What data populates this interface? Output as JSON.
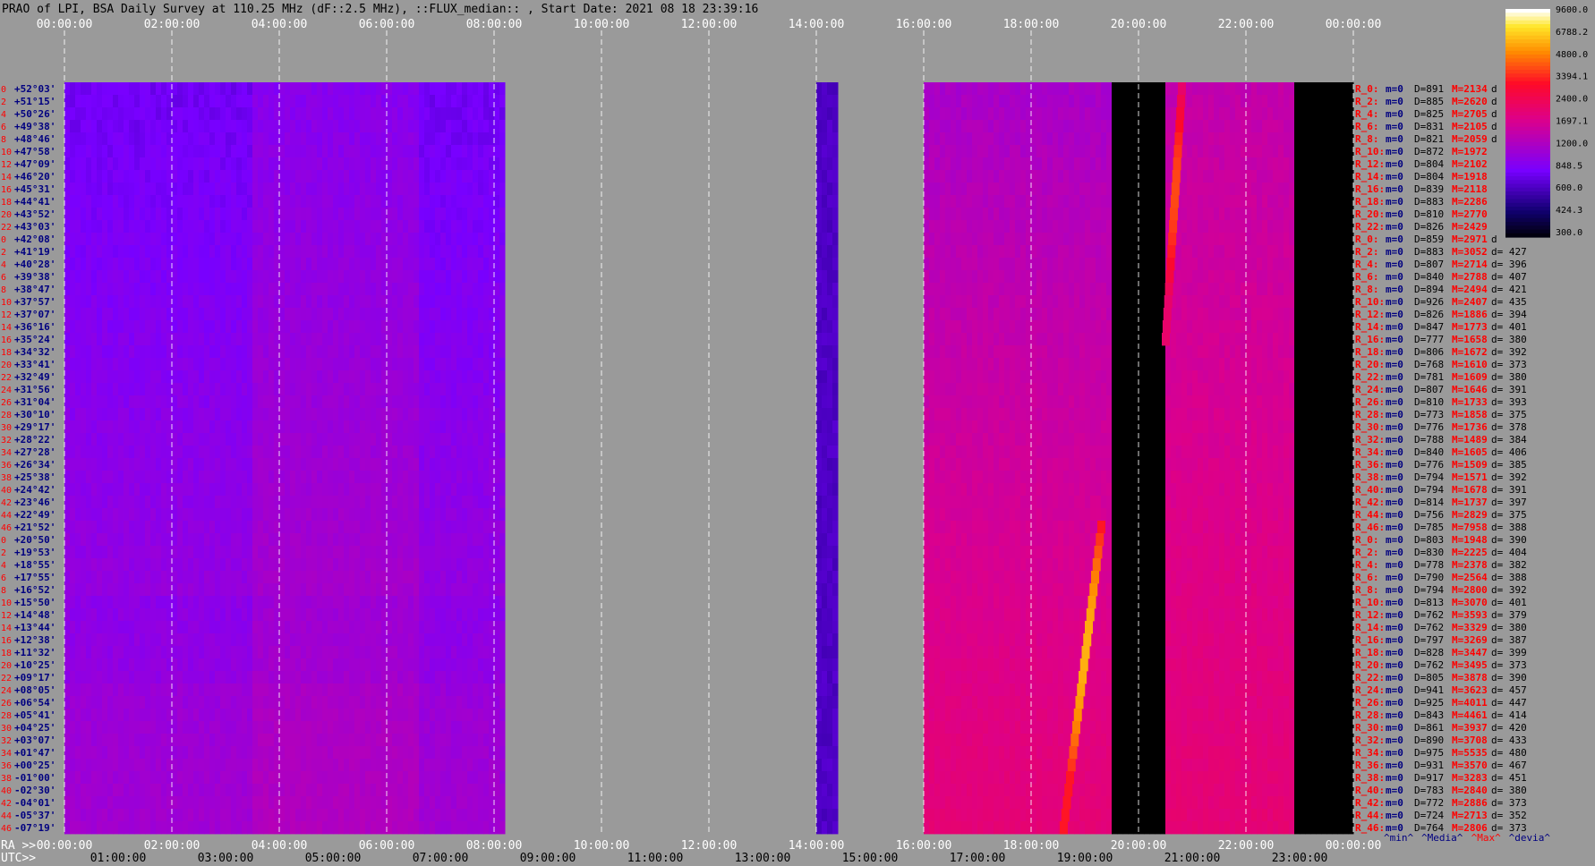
{
  "title": "PRAO of LPI, BSA Daily Survey at 110.25 MHz (dF::2.5 MHz), ::FLUX_median:: , Start Date: 2021 08 18 23:39:16",
  "chart_data": {
    "type": "heatmap",
    "title": "PRAO of LPI, BSA Daily Survey at 110.25 MHz (dF::2.5 MHz), ::FLUX_median:: , Start Date: 2021 08 18 23:39:16",
    "x_axis_top": {
      "ticks": [
        "00:00:00",
        "02:00:00",
        "04:00:00",
        "06:00:00",
        "08:00:00",
        "10:00:00",
        "12:00:00",
        "14:00:00",
        "16:00:00",
        "18:00:00",
        "20:00:00",
        "22:00:00",
        "00:00:00"
      ]
    },
    "x_axis_ra": {
      "label": "RA >>",
      "ticks": [
        "00:00:00",
        "02:00:00",
        "04:00:00",
        "06:00:00",
        "08:00:00",
        "10:00:00",
        "12:00:00",
        "14:00:00",
        "16:00:00",
        "18:00:00",
        "20:00:00",
        "22:00:00",
        "00:00:00"
      ]
    },
    "x_axis_utc": {
      "label": "UTC>>",
      "ticks": [
        "01:00:00",
        "03:00:00",
        "05:00:00",
        "07:00:00",
        "09:00:00",
        "11:00:00",
        "13:00:00",
        "15:00:00",
        "17:00:00",
        "19:00:00",
        "21:00:00",
        "23:00:00"
      ]
    },
    "row_numbers": [
      "0",
      "2",
      "4",
      "6",
      "8",
      "10",
      "12",
      "14",
      "16",
      "18",
      "20",
      "22",
      "0",
      "2",
      "4",
      "6",
      "8",
      "10",
      "12",
      "14",
      "16",
      "18",
      "20",
      "22",
      "24",
      "26",
      "28",
      "30",
      "32",
      "34",
      "36",
      "38",
      "40",
      "42",
      "44",
      "46",
      "0",
      "2",
      "4",
      "6",
      "8",
      "10",
      "12",
      "14",
      "16",
      "18",
      "20",
      "22",
      "24",
      "26",
      "28",
      "30",
      "32",
      "34",
      "36",
      "38",
      "40",
      "42",
      "44",
      "46"
    ],
    "declinations": [
      "+52°03'",
      "+51°15'",
      "+50°26'",
      "+49°38'",
      "+48°46'",
      "+47°58'",
      "+47°09'",
      "+46°20'",
      "+45°31'",
      "+44°41'",
      "+43°52'",
      "+43°03'",
      "+42°08'",
      "+41°19'",
      "+40°28'",
      "+39°38'",
      "+38°47'",
      "+37°57'",
      "+37°07'",
      "+36°16'",
      "+35°24'",
      "+34°32'",
      "+33°41'",
      "+32°49'",
      "+31°56'",
      "+31°04'",
      "+30°10'",
      "+29°17'",
      "+28°22'",
      "+27°28'",
      "+26°34'",
      "+25°38'",
      "+24°42'",
      "+23°46'",
      "+22°49'",
      "+21°52'",
      "+20°50'",
      "+19°53'",
      "+18°55'",
      "+17°55'",
      "+16°52'",
      "+15°50'",
      "+14°48'",
      "+13°44'",
      "+12°38'",
      "+11°32'",
      "+10°25'",
      "+09°17'",
      "+08°05'",
      "+06°54'",
      "+05°41'",
      "+04°25'",
      "+03°07'",
      "+01°47'",
      "+00°25'",
      "-01°00'",
      "-02°30'",
      "-04°01'",
      "-05°37'",
      "-07°19'"
    ],
    "colorbar": {
      "ticks": [
        "9600.0",
        "6788.2",
        "4800.0",
        "3394.1",
        "2400.0",
        "1697.1",
        "1200.0",
        "848.5",
        "600.0",
        "424.3",
        "300.0"
      ]
    },
    "data_segments_hours": [
      [
        0.0,
        8.2
      ],
      [
        14.0,
        14.4
      ],
      [
        16.0,
        19.5
      ],
      [
        19.5,
        20.5
      ],
      [
        20.5,
        22.9
      ],
      [
        22.9,
        24.0
      ]
    ],
    "source_tracks": [
      {
        "dec_start": "+21°52'",
        "dec_end": "-07°19'",
        "ra_start": 19.3,
        "ra_end": 18.6,
        "peak_flux": 6000
      },
      {
        "dec_start": "+52°03'",
        "dec_end": "+35°24'",
        "ra_start": 20.8,
        "ra_end": 20.5,
        "peak_flux": 4000
      }
    ],
    "legend_footer": [
      {
        "text": "^min^",
        "color": "#000080"
      },
      {
        "text": "^Media^",
        "color": "#000080"
      },
      {
        "text": "^Max^",
        "color": "#ff0000"
      },
      {
        "text": "^devia^",
        "color": "#000080"
      }
    ],
    "row_stats": [
      {
        "r": "R_0:",
        "m": "m=0",
        "D": "D=891",
        "M": "M=2134",
        "d": "d"
      },
      {
        "r": "R_2:",
        "m": "m=0",
        "D": "D=885",
        "M": "M=2620",
        "d": "d"
      },
      {
        "r": "R_4:",
        "m": "m=0",
        "D": "D=825",
        "M": "M=2705",
        "d": "d"
      },
      {
        "r": "R_6:",
        "m": "m=0",
        "D": "D=831",
        "M": "M=2105",
        "d": "d"
      },
      {
        "r": "R_8:",
        "m": "m=0",
        "D": "D=821",
        "M": "M=2059",
        "d": "d"
      },
      {
        "r": "R_10:",
        "m": "m=0",
        "D": "D=872",
        "M": "M=1972",
        "d": ""
      },
      {
        "r": "R_12:",
        "m": "m=0",
        "D": "D=804",
        "M": "M=2102",
        "d": ""
      },
      {
        "r": "R_14:",
        "m": "m=0",
        "D": "D=804",
        "M": "M=1918",
        "d": ""
      },
      {
        "r": "R_16:",
        "m": "m=0",
        "D": "D=839",
        "M": "M=2118",
        "d": ""
      },
      {
        "r": "R_18:",
        "m": "m=0",
        "D": "D=883",
        "M": "M=2286",
        "d": ""
      },
      {
        "r": "R_20:",
        "m": "m=0",
        "D": "D=810",
        "M": "M=2770",
        "d": ""
      },
      {
        "r": "R_22:",
        "m": "m=0",
        "D": "D=826",
        "M": "M=2429",
        "d": ""
      },
      {
        "r": "R_0:",
        "m": "m=0",
        "D": "D=859",
        "M": "M=2971",
        "d": "d"
      },
      {
        "r": "R_2:",
        "m": "m=0",
        "D": "D=883",
        "M": "M=3052",
        "d": "d= 427"
      },
      {
        "r": "R_4:",
        "m": "m=0",
        "D": "D=807",
        "M": "M=2714",
        "d": "d= 396"
      },
      {
        "r": "R_6:",
        "m": "m=0",
        "D": "D=840",
        "M": "M=2788",
        "d": "d= 407"
      },
      {
        "r": "R_8:",
        "m": "m=0",
        "D": "D=894",
        "M": "M=2494",
        "d": "d= 421"
      },
      {
        "r": "R_10:",
        "m": "m=0",
        "D": "D=926",
        "M": "M=2407",
        "d": "d= 435"
      },
      {
        "r": "R_12:",
        "m": "m=0",
        "D": "D=826",
        "M": "M=1886",
        "d": "d= 394"
      },
      {
        "r": "R_14:",
        "m": "m=0",
        "D": "D=847",
        "M": "M=1773",
        "d": "d= 401"
      },
      {
        "r": "R_16:",
        "m": "m=0",
        "D": "D=777",
        "M": "M=1658",
        "d": "d= 380"
      },
      {
        "r": "R_18:",
        "m": "m=0",
        "D": "D=806",
        "M": "M=1672",
        "d": "d= 392"
      },
      {
        "r": "R_20:",
        "m": "m=0",
        "D": "D=768",
        "M": "M=1610",
        "d": "d= 373"
      },
      {
        "r": "R_22:",
        "m": "m=0",
        "D": "D=781",
        "M": "M=1609",
        "d": "d= 380"
      },
      {
        "r": "R_24:",
        "m": "m=0",
        "D": "D=807",
        "M": "M=1646",
        "d": "d= 391"
      },
      {
        "r": "R_26:",
        "m": "m=0",
        "D": "D=810",
        "M": "M=1733",
        "d": "d= 393"
      },
      {
        "r": "R_28:",
        "m": "m=0",
        "D": "D=773",
        "M": "M=1858",
        "d": "d= 375"
      },
      {
        "r": "R_30:",
        "m": "m=0",
        "D": "D=776",
        "M": "M=1736",
        "d": "d= 378"
      },
      {
        "r": "R_32:",
        "m": "m=0",
        "D": "D=788",
        "M": "M=1489",
        "d": "d= 384"
      },
      {
        "r": "R_34:",
        "m": "m=0",
        "D": "D=840",
        "M": "M=1605",
        "d": "d= 406"
      },
      {
        "r": "R_36:",
        "m": "m=0",
        "D": "D=776",
        "M": "M=1509",
        "d": "d= 385"
      },
      {
        "r": "R_38:",
        "m": "m=0",
        "D": "D=794",
        "M": "M=1571",
        "d": "d= 392"
      },
      {
        "r": "R_40:",
        "m": "m=0",
        "D": "D=794",
        "M": "M=1678",
        "d": "d= 391"
      },
      {
        "r": "R_42:",
        "m": "m=0",
        "D": "D=814",
        "M": "M=1737",
        "d": "d= 397"
      },
      {
        "r": "R_44:",
        "m": "m=0",
        "D": "D=756",
        "M": "M=2829",
        "d": "d= 375"
      },
      {
        "r": "R_46:",
        "m": "m=0",
        "D": "D=785",
        "M": "M=7958",
        "d": "d= 388"
      },
      {
        "r": "R_0:",
        "m": "m=0",
        "D": "D=803",
        "M": "M=1948",
        "d": "d= 390"
      },
      {
        "r": "R_2:",
        "m": "m=0",
        "D": "D=830",
        "M": "M=2225",
        "d": "d= 404"
      },
      {
        "r": "R_4:",
        "m": "m=0",
        "D": "D=778",
        "M": "M=2378",
        "d": "d= 382"
      },
      {
        "r": "R_6:",
        "m": "m=0",
        "D": "D=790",
        "M": "M=2564",
        "d": "d= 388"
      },
      {
        "r": "R_8:",
        "m": "m=0",
        "D": "D=794",
        "M": "M=2800",
        "d": "d= 392"
      },
      {
        "r": "R_10:",
        "m": "m=0",
        "D": "D=813",
        "M": "M=3070",
        "d": "d= 401"
      },
      {
        "r": "R_12:",
        "m": "m=0",
        "D": "D=762",
        "M": "M=3593",
        "d": "d= 379"
      },
      {
        "r": "R_14:",
        "m": "m=0",
        "D": "D=762",
        "M": "M=3329",
        "d": "d= 380"
      },
      {
        "r": "R_16:",
        "m": "m=0",
        "D": "D=797",
        "M": "M=3269",
        "d": "d= 387"
      },
      {
        "r": "R_18:",
        "m": "m=0",
        "D": "D=828",
        "M": "M=3447",
        "d": "d= 399"
      },
      {
        "r": "R_20:",
        "m": "m=0",
        "D": "D=762",
        "M": "M=3495",
        "d": "d= 373"
      },
      {
        "r": "R_22:",
        "m": "m=0",
        "D": "D=805",
        "M": "M=3878",
        "d": "d= 390"
      },
      {
        "r": "R_24:",
        "m": "m=0",
        "D": "D=941",
        "M": "M=3623",
        "d": "d= 457"
      },
      {
        "r": "R_26:",
        "m": "m=0",
        "D": "D=925",
        "M": "M=4011",
        "d": "d= 447"
      },
      {
        "r": "R_28:",
        "m": "m=0",
        "D": "D=843",
        "M": "M=4461",
        "d": "d= 414"
      },
      {
        "r": "R_30:",
        "m": "m=0",
        "D": "D=861",
        "M": "M=3937",
        "d": "d= 420"
      },
      {
        "r": "R_32:",
        "m": "m=0",
        "D": "D=890",
        "M": "M=3708",
        "d": "d= 433"
      },
      {
        "r": "R_34:",
        "m": "m=0",
        "D": "D=975",
        "M": "M=5535",
        "d": "d= 480"
      },
      {
        "r": "R_36:",
        "m": "m=0",
        "D": "D=931",
        "M": "M=3570",
        "d": "d= 467"
      },
      {
        "r": "R_38:",
        "m": "m=0",
        "D": "D=917",
        "M": "M=3283",
        "d": "d= 451"
      },
      {
        "r": "R_40:",
        "m": "m=0",
        "D": "D=783",
        "M": "M=2840",
        "d": "d= 380"
      },
      {
        "r": "R_42:",
        "m": "m=0",
        "D": "D=772",
        "M": "M=2886",
        "d": "d= 373"
      },
      {
        "r": "R_44:",
        "m": "m=0",
        "D": "D=724",
        "M": "M=2713",
        "d": "d= 352"
      },
      {
        "r": "R_46:",
        "m": "m=0",
        "D": "D=764",
        "M": "M=2806",
        "d": "d= 373"
      }
    ]
  }
}
